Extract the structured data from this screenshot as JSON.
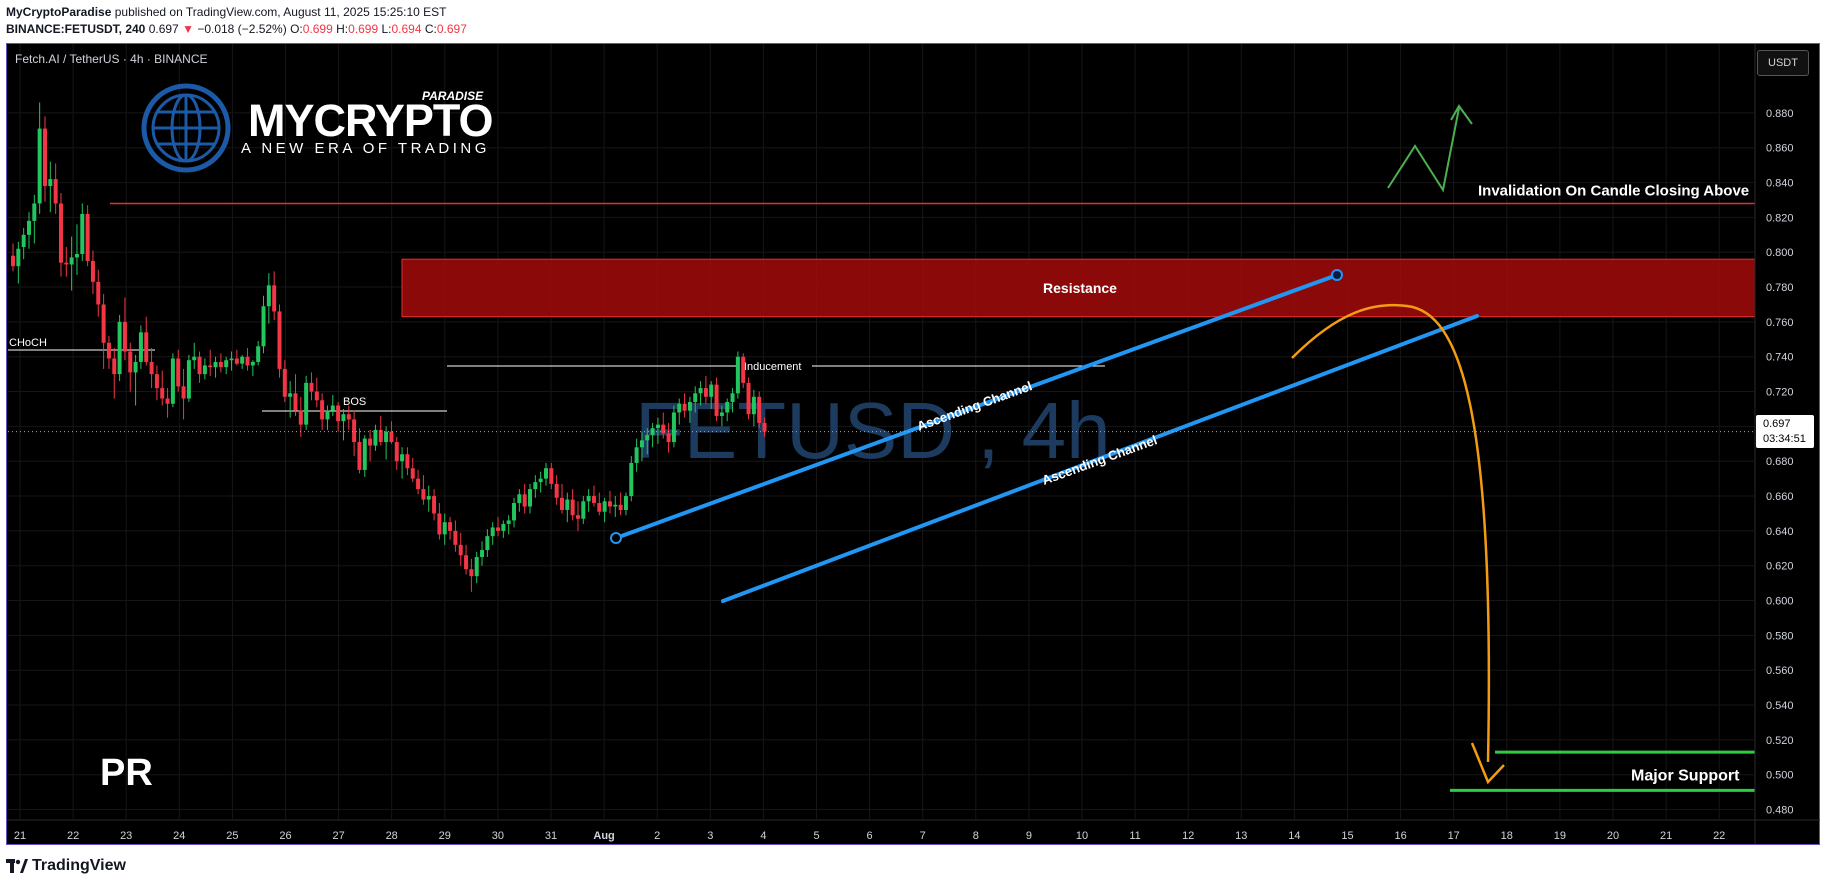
{
  "header": {
    "author": "MyCryptoParadise",
    "published_text": "published on TradingView.com, August 11, 2025 15:25:10 EST",
    "symbol_code": "BINANCE:FETUSDT, 240",
    "last": "0.697",
    "change_arrow": "▼",
    "change": "−0.018 (−2.52%)",
    "o_label": "O:",
    "o": "0.699",
    "h_label": "H:",
    "h": "0.699",
    "l_label": "L:",
    "l": "0.694",
    "c_label": "C:",
    "c": "0.697"
  },
  "symbol_label": "Fetch.AI / TetherUS · 4h · BINANCE",
  "currency_button": "USDT",
  "price_tag": {
    "value": "0.697",
    "countdown": "03:34:51"
  },
  "watermark": {
    "brand_my": "MY",
    "brand_crypto": "CRYPTO",
    "paradise": "PARADISE",
    "tagline": "A NEW ERA OF TRADING",
    "symbol_watermark": "FETUSD , 4h"
  },
  "pr_label": "PR",
  "footer": {
    "logo_text": "TradingView"
  },
  "colors": {
    "background": "#000000",
    "up_candle": "#22c55e",
    "down_candle": "#f23645",
    "resistance_zone": "#a40a0a",
    "invalidation_line": "#f23645",
    "channel": "#2196f3",
    "projection_arrow": "#f39c12",
    "support": "#2ecc40",
    "bullish_arrow": "#4caf50"
  },
  "chart_data": {
    "type": "candlestick",
    "x_labels": [
      "21",
      "22",
      "23",
      "24",
      "25",
      "26",
      "27",
      "28",
      "29",
      "30",
      "31",
      "Aug",
      "2",
      "3",
      "4",
      "5",
      "6",
      "7",
      "8",
      "9",
      "10",
      "11",
      "12",
      "13",
      "14",
      "15",
      "16",
      "17",
      "18",
      "19",
      "20",
      "21",
      "22"
    ],
    "y_ticks": [
      "0.880",
      "0.860",
      "0.840",
      "0.820",
      "0.800",
      "0.780",
      "0.760",
      "0.740",
      "0.720",
      "0.700",
      "0.680",
      "0.660",
      "0.640",
      "0.620",
      "0.600",
      "0.580",
      "0.560",
      "0.540",
      "0.520",
      "0.500",
      "0.480"
    ],
    "ylim": [
      0.474,
      0.892
    ],
    "candles": [
      [
        0.798,
        0.805,
        0.789,
        0.792
      ],
      [
        0.792,
        0.806,
        0.782,
        0.802
      ],
      [
        0.803,
        0.814,
        0.796,
        0.81
      ],
      [
        0.81,
        0.823,
        0.802,
        0.818
      ],
      [
        0.818,
        0.833,
        0.805,
        0.828
      ],
      [
        0.828,
        0.886,
        0.822,
        0.871
      ],
      [
        0.871,
        0.878,
        0.829,
        0.838
      ],
      [
        0.838,
        0.852,
        0.823,
        0.842
      ],
      [
        0.842,
        0.851,
        0.822,
        0.828
      ],
      [
        0.828,
        0.834,
        0.786,
        0.794
      ],
      [
        0.794,
        0.803,
        0.786,
        0.793
      ],
      [
        0.793,
        0.809,
        0.778,
        0.797
      ],
      [
        0.797,
        0.816,
        0.787,
        0.799
      ],
      [
        0.799,
        0.828,
        0.795,
        0.822
      ],
      [
        0.822,
        0.827,
        0.792,
        0.795
      ],
      [
        0.795,
        0.801,
        0.776,
        0.783
      ],
      [
        0.783,
        0.79,
        0.763,
        0.77
      ],
      [
        0.77,
        0.776,
        0.733,
        0.748
      ],
      [
        0.748,
        0.752,
        0.733,
        0.739
      ],
      [
        0.739,
        0.745,
        0.716,
        0.73
      ],
      [
        0.73,
        0.764,
        0.726,
        0.76
      ],
      [
        0.76,
        0.774,
        0.738,
        0.743
      ],
      [
        0.743,
        0.748,
        0.72,
        0.731
      ],
      [
        0.731,
        0.741,
        0.712,
        0.737
      ],
      [
        0.737,
        0.758,
        0.733,
        0.754
      ],
      [
        0.754,
        0.763,
        0.735,
        0.737
      ],
      [
        0.737,
        0.745,
        0.722,
        0.73
      ],
      [
        0.73,
        0.735,
        0.715,
        0.722
      ],
      [
        0.722,
        0.732,
        0.712,
        0.716
      ],
      [
        0.716,
        0.722,
        0.705,
        0.713
      ],
      [
        0.713,
        0.742,
        0.711,
        0.739
      ],
      [
        0.739,
        0.744,
        0.72,
        0.723
      ],
      [
        0.723,
        0.733,
        0.704,
        0.716
      ],
      [
        0.716,
        0.741,
        0.714,
        0.738
      ],
      [
        0.738,
        0.748,
        0.733,
        0.74
      ],
      [
        0.74,
        0.743,
        0.725,
        0.73
      ],
      [
        0.73,
        0.739,
        0.727,
        0.735
      ],
      [
        0.735,
        0.744,
        0.729,
        0.734
      ],
      [
        0.734,
        0.74,
        0.728,
        0.737
      ],
      [
        0.737,
        0.742,
        0.731,
        0.734
      ],
      [
        0.734,
        0.74,
        0.73,
        0.738
      ],
      [
        0.738,
        0.743,
        0.732,
        0.739
      ],
      [
        0.739,
        0.744,
        0.735,
        0.736
      ],
      [
        0.736,
        0.741,
        0.733,
        0.74
      ],
      [
        0.74,
        0.745,
        0.732,
        0.735
      ],
      [
        0.735,
        0.738,
        0.729,
        0.737
      ],
      [
        0.737,
        0.749,
        0.735,
        0.746
      ],
      [
        0.746,
        0.775,
        0.742,
        0.769
      ],
      [
        0.769,
        0.788,
        0.759,
        0.781
      ],
      [
        0.781,
        0.789,
        0.761,
        0.766
      ],
      [
        0.766,
        0.77,
        0.728,
        0.733
      ],
      [
        0.733,
        0.738,
        0.714,
        0.717
      ],
      [
        0.717,
        0.726,
        0.705,
        0.719
      ],
      [
        0.719,
        0.73,
        0.706,
        0.709
      ],
      [
        0.709,
        0.717,
        0.694,
        0.701
      ],
      [
        0.701,
        0.729,
        0.698,
        0.725
      ],
      [
        0.725,
        0.731,
        0.715,
        0.72
      ],
      [
        0.72,
        0.728,
        0.711,
        0.715
      ],
      [
        0.715,
        0.719,
        0.698,
        0.704
      ],
      [
        0.704,
        0.712,
        0.698,
        0.709
      ],
      [
        0.709,
        0.718,
        0.706,
        0.712
      ],
      [
        0.712,
        0.714,
        0.697,
        0.703
      ],
      [
        0.703,
        0.71,
        0.692,
        0.707
      ],
      [
        0.707,
        0.712,
        0.698,
        0.704
      ],
      [
        0.704,
        0.709,
        0.683,
        0.691
      ],
      [
        0.691,
        0.699,
        0.673,
        0.675
      ],
      [
        0.675,
        0.695,
        0.671,
        0.693
      ],
      [
        0.693,
        0.698,
        0.68,
        0.689
      ],
      [
        0.689,
        0.701,
        0.686,
        0.698
      ],
      [
        0.698,
        0.706,
        0.689,
        0.691
      ],
      [
        0.691,
        0.7,
        0.681,
        0.697
      ],
      [
        0.697,
        0.703,
        0.69,
        0.691
      ],
      [
        0.691,
        0.694,
        0.675,
        0.68
      ],
      [
        0.68,
        0.688,
        0.67,
        0.684
      ],
      [
        0.684,
        0.688,
        0.672,
        0.676
      ],
      [
        0.676,
        0.682,
        0.668,
        0.67
      ],
      [
        0.67,
        0.675,
        0.661,
        0.664
      ],
      [
        0.664,
        0.672,
        0.655,
        0.658
      ],
      [
        0.658,
        0.666,
        0.651,
        0.66
      ],
      [
        0.66,
        0.664,
        0.646,
        0.65
      ],
      [
        0.65,
        0.656,
        0.635,
        0.638
      ],
      [
        0.638,
        0.65,
        0.632,
        0.645
      ],
      [
        0.645,
        0.648,
        0.635,
        0.64
      ],
      [
        0.64,
        0.646,
        0.628,
        0.632
      ],
      [
        0.632,
        0.639,
        0.62,
        0.626
      ],
      [
        0.626,
        0.632,
        0.615,
        0.618
      ],
      [
        0.618,
        0.624,
        0.605,
        0.614
      ],
      [
        0.614,
        0.628,
        0.61,
        0.625
      ],
      [
        0.625,
        0.634,
        0.62,
        0.629
      ],
      [
        0.629,
        0.641,
        0.625,
        0.637
      ],
      [
        0.637,
        0.645,
        0.632,
        0.642
      ],
      [
        0.642,
        0.648,
        0.637,
        0.64
      ],
      [
        0.64,
        0.646,
        0.636,
        0.644
      ],
      [
        0.644,
        0.649,
        0.638,
        0.646
      ],
      [
        0.646,
        0.659,
        0.642,
        0.656
      ],
      [
        0.656,
        0.664,
        0.651,
        0.661
      ],
      [
        0.661,
        0.667,
        0.65,
        0.654
      ],
      [
        0.654,
        0.667,
        0.65,
        0.664
      ],
      [
        0.664,
        0.672,
        0.659,
        0.668
      ],
      [
        0.668,
        0.674,
        0.662,
        0.67
      ],
      [
        0.67,
        0.679,
        0.666,
        0.676
      ],
      [
        0.676,
        0.679,
        0.664,
        0.667
      ],
      [
        0.667,
        0.672,
        0.655,
        0.659
      ],
      [
        0.659,
        0.667,
        0.65,
        0.652
      ],
      [
        0.652,
        0.662,
        0.645,
        0.658
      ],
      [
        0.658,
        0.664,
        0.646,
        0.649
      ],
      [
        0.649,
        0.657,
        0.64,
        0.647
      ],
      [
        0.647,
        0.66,
        0.644,
        0.657
      ],
      [
        0.657,
        0.664,
        0.651,
        0.66
      ],
      [
        0.66,
        0.666,
        0.654,
        0.656
      ],
      [
        0.656,
        0.662,
        0.649,
        0.651
      ],
      [
        0.651,
        0.659,
        0.645,
        0.657
      ],
      [
        0.657,
        0.663,
        0.65,
        0.654
      ],
      [
        0.654,
        0.66,
        0.648,
        0.655
      ],
      [
        0.655,
        0.662,
        0.649,
        0.652
      ],
      [
        0.652,
        0.662,
        0.649,
        0.66
      ],
      [
        0.66,
        0.683,
        0.657,
        0.679
      ],
      [
        0.679,
        0.693,
        0.674,
        0.688
      ],
      [
        0.688,
        0.697,
        0.68,
        0.692
      ],
      [
        0.692,
        0.699,
        0.684,
        0.695
      ],
      [
        0.695,
        0.702,
        0.688,
        0.699
      ],
      [
        0.699,
        0.705,
        0.69,
        0.701
      ],
      [
        0.701,
        0.708,
        0.693,
        0.696
      ],
      [
        0.696,
        0.702,
        0.685,
        0.691
      ],
      [
        0.691,
        0.712,
        0.688,
        0.708
      ],
      [
        0.708,
        0.716,
        0.701,
        0.713
      ],
      [
        0.713,
        0.719,
        0.705,
        0.709
      ],
      [
        0.709,
        0.717,
        0.702,
        0.714
      ],
      [
        0.714,
        0.723,
        0.708,
        0.719
      ],
      [
        0.719,
        0.726,
        0.712,
        0.722
      ],
      [
        0.722,
        0.729,
        0.713,
        0.717
      ],
      [
        0.717,
        0.726,
        0.71,
        0.724
      ],
      [
        0.724,
        0.728,
        0.703,
        0.706
      ],
      [
        0.706,
        0.712,
        0.7,
        0.708
      ],
      [
        0.708,
        0.716,
        0.703,
        0.714
      ],
      [
        0.714,
        0.722,
        0.708,
        0.719
      ],
      [
        0.719,
        0.743,
        0.716,
        0.74
      ],
      [
        0.74,
        0.742,
        0.722,
        0.725
      ],
      [
        0.725,
        0.728,
        0.704,
        0.707
      ],
      [
        0.707,
        0.721,
        0.7,
        0.717
      ],
      [
        0.717,
        0.72,
        0.699,
        0.702
      ],
      [
        0.702,
        0.705,
        0.694,
        0.697
      ]
    ],
    "annotations": {
      "choch": "CHoCH",
      "bos": "BOS",
      "inducement": "Inducement",
      "resistance": "Resistance",
      "resistance_zone": [
        0.763,
        0.796
      ],
      "invalidation": "Invalidation On Candle Closing Above",
      "invalidation_level": 0.828,
      "channel_upper": "Ascending Channel",
      "channel_lower": "Ascending Channel",
      "major_support": "Major Support",
      "support_level": 0.491,
      "support_level_upper": 0.513
    }
  }
}
